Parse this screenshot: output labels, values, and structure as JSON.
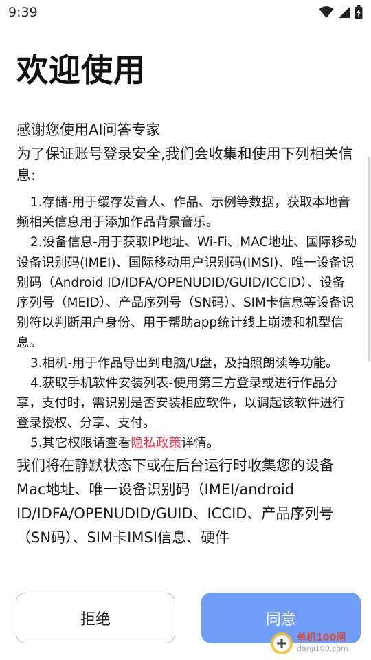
{
  "status_bar": {
    "time": "9:39",
    "icons": [
      "wifi-icon",
      "cellular-signal-icon",
      "battery-charging-icon"
    ]
  },
  "title": "欢迎使用",
  "intro": {
    "greeting": "感谢您使用AI问答专家",
    "purpose": "为了保证账号登录安全,我们会收集和使用下列相关信息:"
  },
  "permissions": [
    "1.存储-用于缓存发音人、作品、示例等数据，获取本地音频相关信息用于添加作品背景音乐。",
    "2.设备信息-用于获取IP地址、Wi-Fi、MAC地址、国际移动设备识别码(IMEI)、国际移动用户识别码(IMSI)、唯一设备识别码（Android ID/IDFA/OPENUDID/GUID/ICCID）、设备序列号（MEID）、产品序列号（SN码）、SIM卡信息等设备识别符以判断用户身份、用于帮助app统计线上崩溃和机型信息。",
    "3.相机-用于作品导出到电脑/U盘，及拍照朗读等功能。",
    "4.获取手机软件安装列表-使用第三方登录或进行作品分享，支付时，需识别是否安装相应软件，以调起该软件进行登录授权、分享、支付。"
  ],
  "privacy_item": {
    "prefix": "5.其它权限请查看",
    "link": "隐私政策",
    "suffix": "详情。"
  },
  "closing": "我们将在静默状态下或在后台运行时收集您的设备Mac地址、唯一设备识别码（IMEI/android ID/IDFA/OPENUDID/GUID、ICCID、产品序列号（SN码）、SIM卡IMSI信息、硬件",
  "buttons": {
    "reject": "拒绝",
    "agree": "同意"
  },
  "watermark": {
    "name": "单机100网",
    "url": "danji100.com"
  },
  "colors": {
    "agree_button": "#6f9df7",
    "link": "#e8364d"
  }
}
